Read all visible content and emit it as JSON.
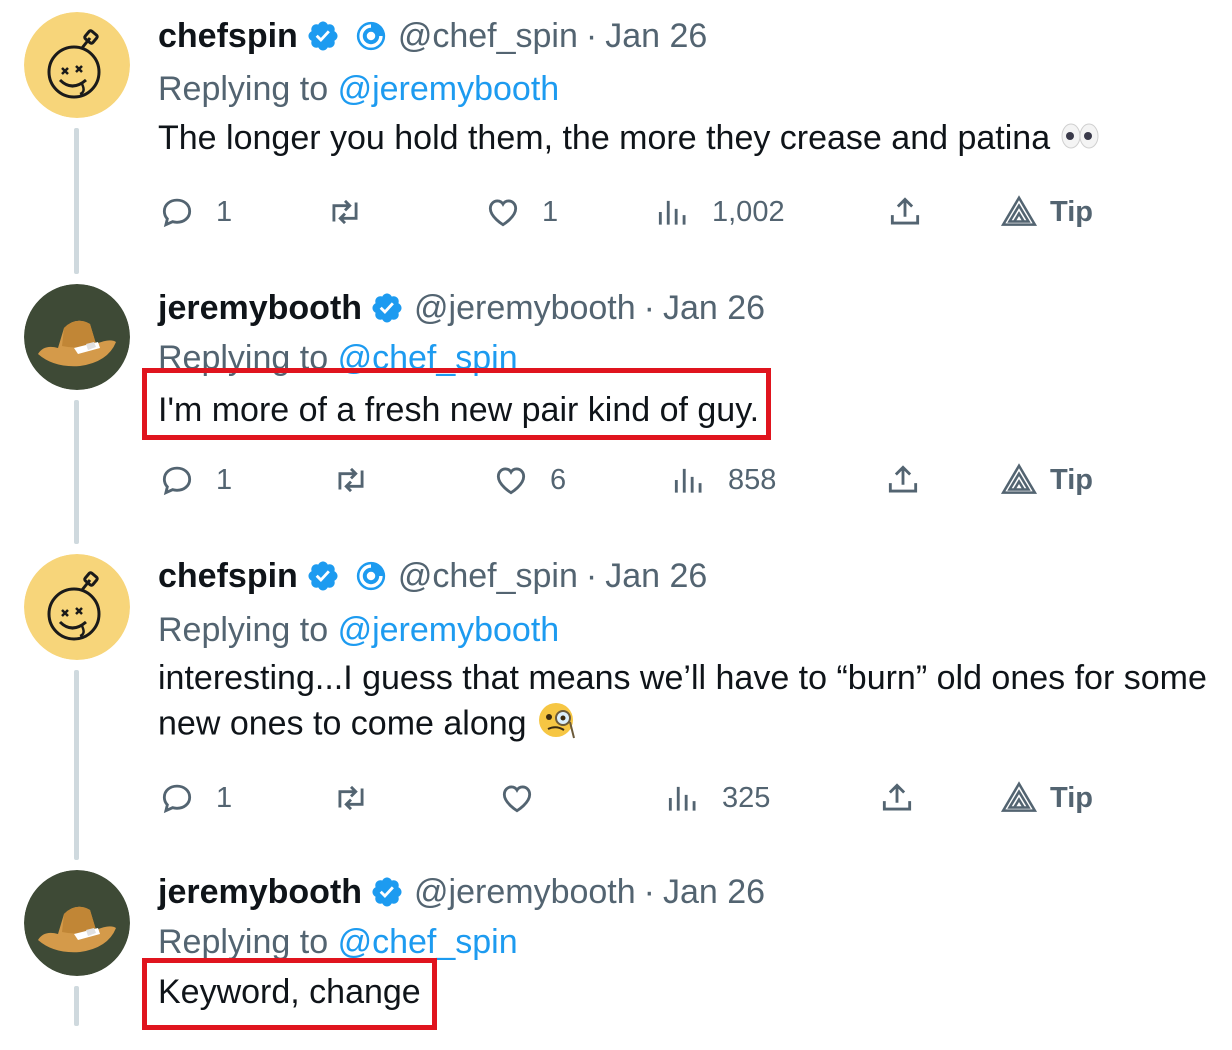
{
  "tweets": [
    {
      "name": "chefspin",
      "handle": "@chef_spin",
      "separator": "·",
      "date": "Jan 26",
      "replying_prefix": "Replying to",
      "replying_to": "@jeremybooth",
      "text": "The longer you hold them, the more they crease and patina",
      "emoji": "eyes-emoji",
      "avatar": "bomb-smiley-avatar",
      "replies": "1",
      "retweets": "",
      "likes": "1",
      "views": "1,002",
      "tip_label": "Tip"
    },
    {
      "name": "jeremybooth",
      "handle": "@jeremybooth",
      "separator": "·",
      "date": "Jan 26",
      "replying_prefix": "Replying to",
      "replying_to": "@chef_spin",
      "text": "I'm more of a fresh new pair kind of guy.",
      "avatar": "cowboy-hat-avatar",
      "replies": "1",
      "retweets": "",
      "likes": "6",
      "views": "858",
      "tip_label": "Tip"
    },
    {
      "name": "chefspin",
      "handle": "@chef_spin",
      "separator": "·",
      "date": "Jan 26",
      "replying_prefix": "Replying to",
      "replying_to": "@jeremybooth",
      "text_line1": "interesting...I guess that means we’ll have to “burn” old ones for some",
      "text_line2": "new ones to come along",
      "emoji": "monocle-face-emoji",
      "avatar": "bomb-smiley-avatar",
      "replies": "1",
      "retweets": "",
      "likes": "",
      "views": "325",
      "tip_label": "Tip"
    },
    {
      "name": "jeremybooth",
      "handle": "@jeremybooth",
      "separator": "·",
      "date": "Jan 26",
      "replying_prefix": "Replying to",
      "replying_to": "@chef_spin",
      "text": "Keyword, change",
      "avatar": "cowboy-hat-avatar"
    }
  ],
  "colors": {
    "verified_blue": "#1d9bf0",
    "secondary_text": "#536471",
    "highlight_red": "#e0141e",
    "thread_line": "#cfd9de"
  }
}
